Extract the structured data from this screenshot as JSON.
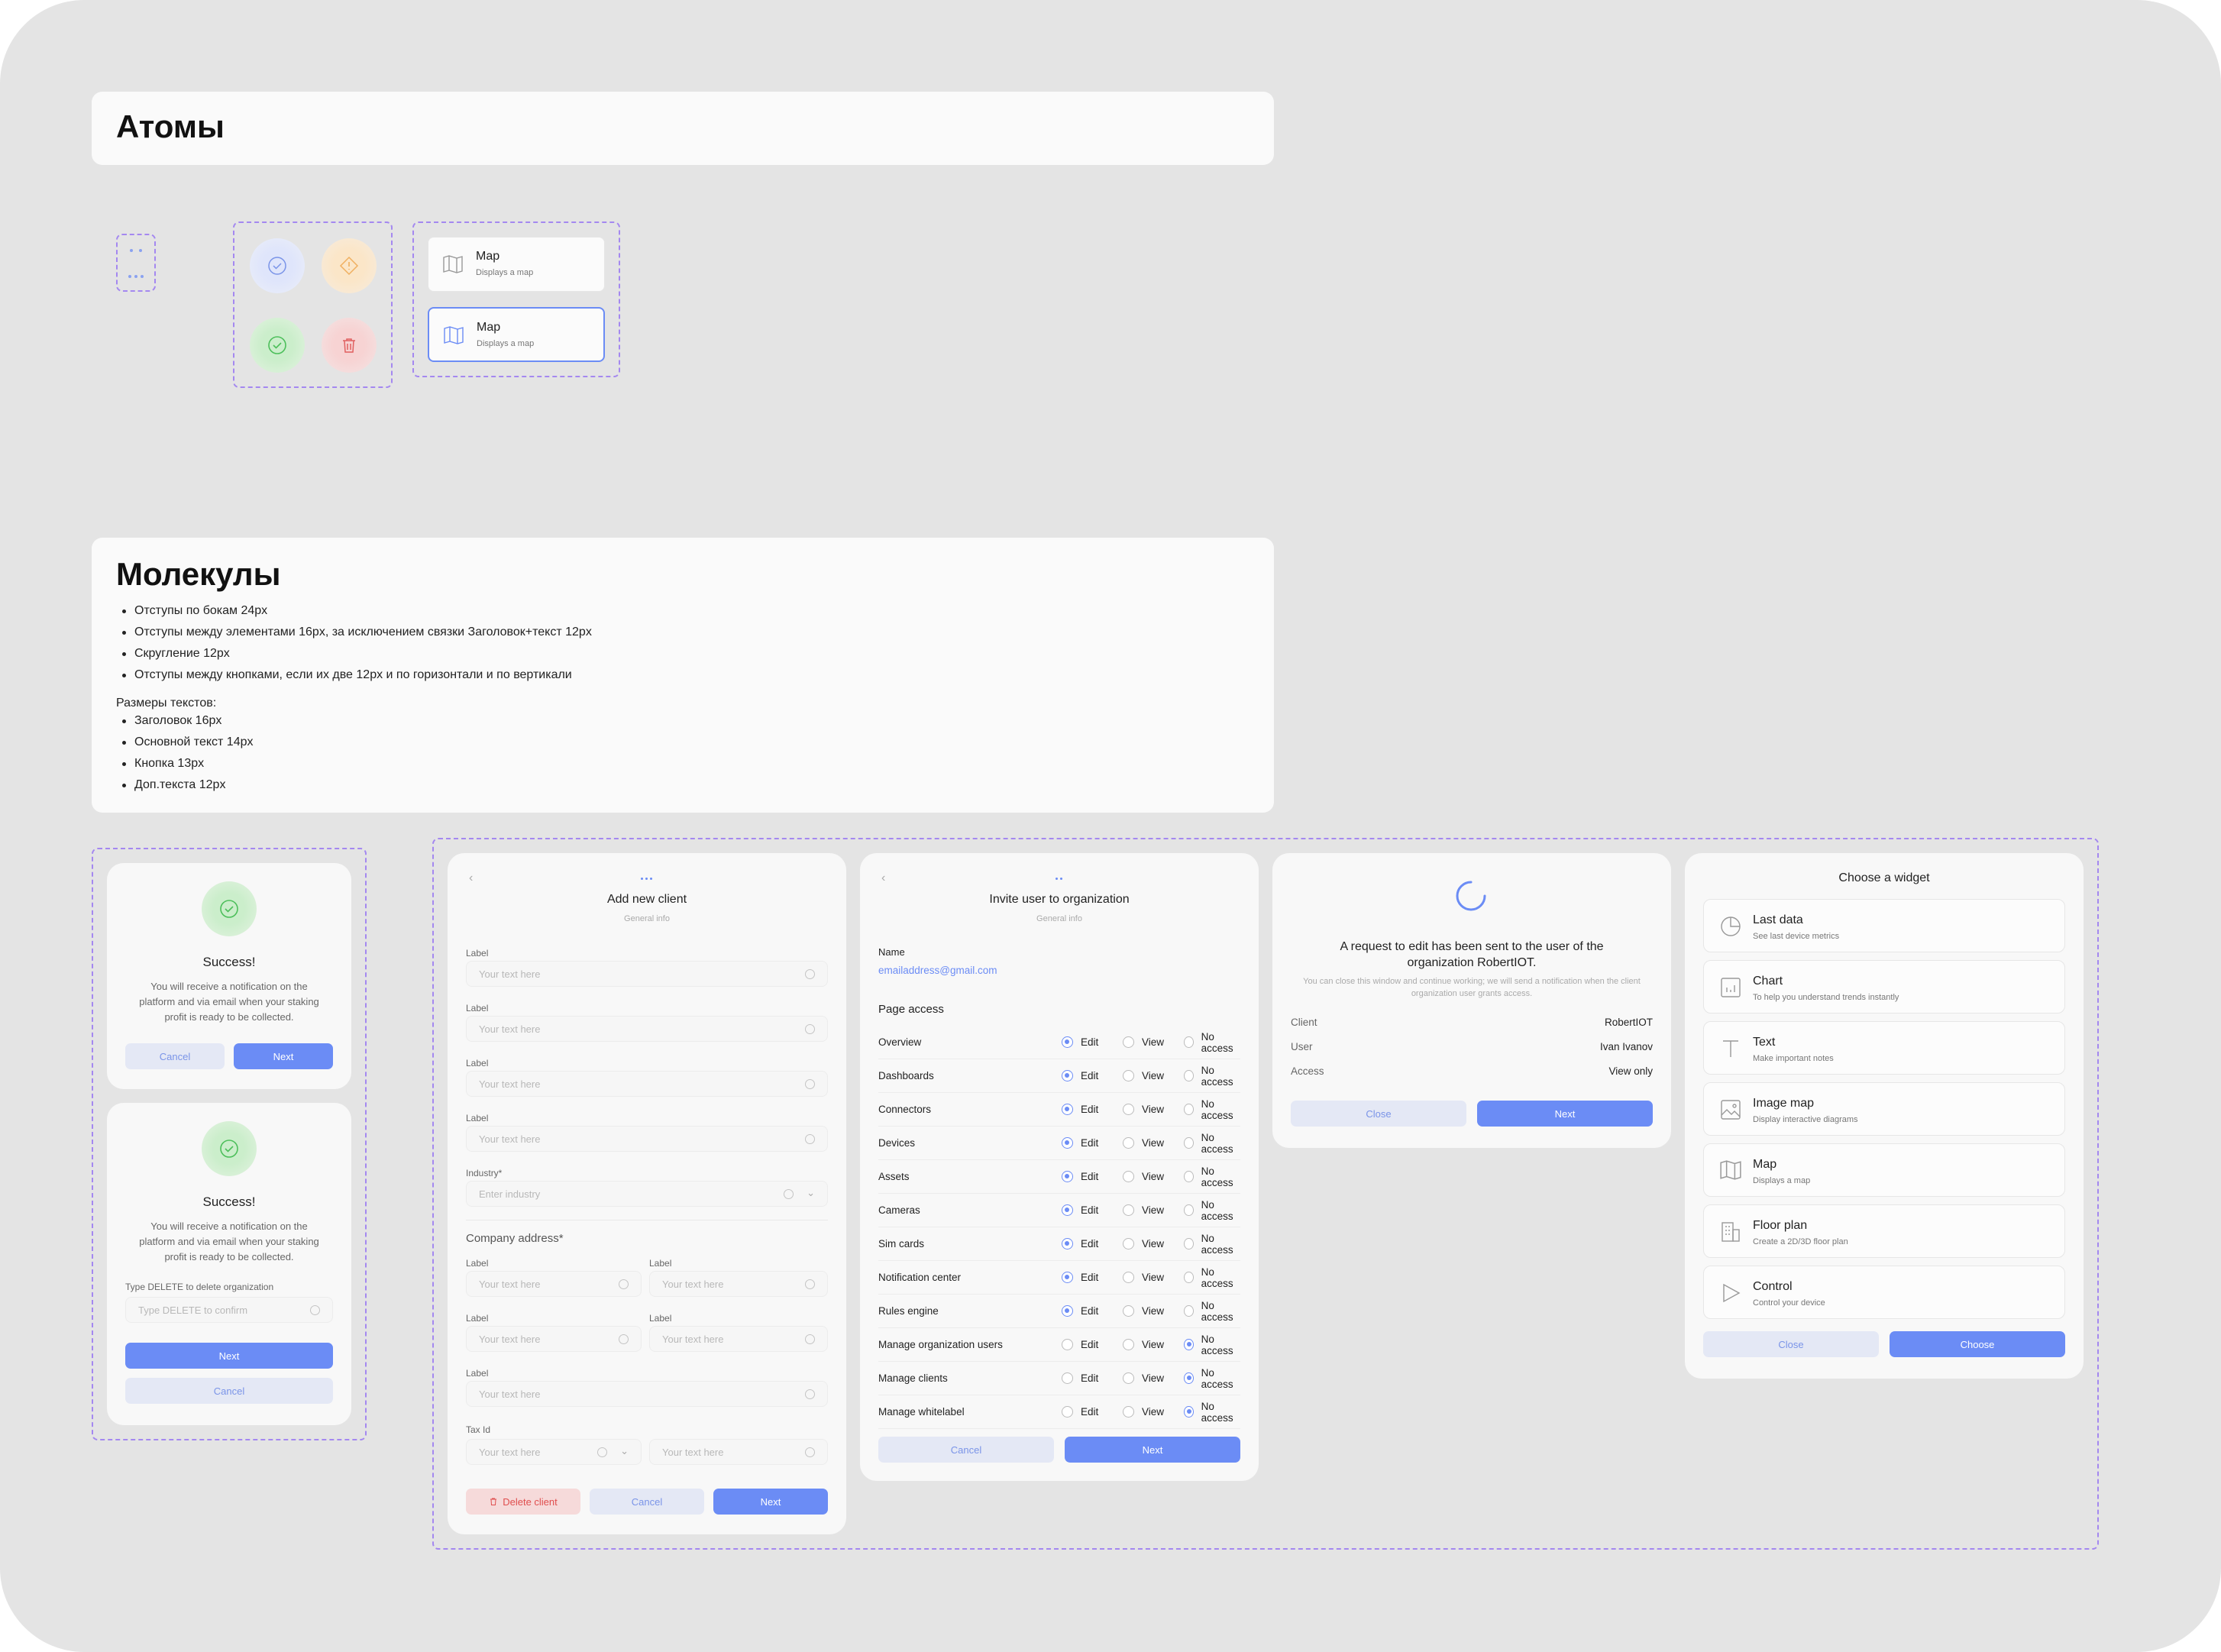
{
  "atoms": {
    "title": "Атомы"
  },
  "map_cards": [
    {
      "title": "Map",
      "subtitle": "Displays a map"
    },
    {
      "title": "Map",
      "subtitle": "Displays a map"
    }
  ],
  "molecules": {
    "title": "Молекулы",
    "rules": [
      "Отступы по бокам 24px",
      "Отступы между элементами 16px, за исключением связки Заголовок+текст 12px",
      "Скругление 12px",
      "Отступы между кнопками, если их две 12px и по горизонтали и по вертикали"
    ],
    "text_sizes_label": "Размеры текстов:",
    "text_sizes": [
      "Заголовок 16px",
      "Основной текст 14px",
      "Кнопка 13px",
      "Доп.текста 12px"
    ]
  },
  "success1": {
    "title": "Success!",
    "body": "You will receive a notification on the platform and via email when your staking profit is ready to be collected.",
    "cancel": "Cancel",
    "next": "Next"
  },
  "success2": {
    "title": "Success!",
    "body": "You will receive a notification on the platform and via email when your staking profit is ready to be collected.",
    "delete_label": "Type DELETE to delete organization",
    "delete_placeholder": "Type DELETE to confirm",
    "next": "Next",
    "cancel": "Cancel"
  },
  "add_client": {
    "title": "Add new client",
    "subtitle": "General info",
    "label": "Label",
    "placeholder": "Your text here",
    "industry_label": "Industry*",
    "industry_placeholder": "Enter industry",
    "company_address": "Company address*",
    "tax_label": "Tax Id",
    "delete": "Delete client",
    "cancel": "Cancel",
    "next": "Next"
  },
  "invite": {
    "title": "Invite user to organization",
    "subtitle": "General info",
    "name_label": "Name",
    "email": "emailaddress@gmail.com",
    "page_access": "Page access",
    "options": [
      "Edit",
      "View",
      "No access"
    ],
    "rows": [
      {
        "name": "Overview",
        "sel": 0
      },
      {
        "name": "Dashboards",
        "sel": 0
      },
      {
        "name": "Connectors",
        "sel": 0
      },
      {
        "name": "Devices",
        "sel": 0
      },
      {
        "name": "Assets",
        "sel": 0
      },
      {
        "name": "Cameras",
        "sel": 0
      },
      {
        "name": "Sim cards",
        "sel": 0
      },
      {
        "name": "Notification center",
        "sel": 0
      },
      {
        "name": "Rules engine",
        "sel": 0
      },
      {
        "name": "Manage organization users",
        "sel": 2
      },
      {
        "name": "Manage clients",
        "sel": 2
      },
      {
        "name": "Manage whitelabel",
        "sel": 2
      }
    ],
    "cancel": "Cancel",
    "next": "Next"
  },
  "request": {
    "title": "A request to edit has been sent to the user of the organization RobertIOT.",
    "note": "You can close this window and continue working; we will send a notification when the client organization user grants access.",
    "rows": [
      {
        "k": "Client",
        "v": "RobertIOT"
      },
      {
        "k": "User",
        "v": "Ivan Ivanov"
      },
      {
        "k": "Access",
        "v": "View only"
      }
    ],
    "close": "Close",
    "next": "Next"
  },
  "widget": {
    "title": "Choose a widget",
    "items": [
      {
        "title": "Last data",
        "subtitle": "See last device metrics",
        "icon": "pie-icon"
      },
      {
        "title": "Chart",
        "subtitle": "To help you understand trends instantly",
        "icon": "chart-icon"
      },
      {
        "title": "Text",
        "subtitle": "Make important notes",
        "icon": "text-icon"
      },
      {
        "title": "Image map",
        "subtitle": "Display interactive diagrams",
        "icon": "image-icon"
      },
      {
        "title": "Map",
        "subtitle": "Displays a map",
        "icon": "map-icon"
      },
      {
        "title": "Floor plan",
        "subtitle": "Create a 2D/3D floor plan",
        "icon": "building-icon"
      },
      {
        "title": "Control",
        "subtitle": "Control your device",
        "icon": "play-icon"
      }
    ],
    "close": "Close",
    "choose": "Choose"
  },
  "colors": {
    "primary": "#6b8cf5",
    "secondary": "#e4e8f5",
    "danger": "#e04e4e",
    "dashed": "#a488f0",
    "success": "#4cbf5a"
  }
}
